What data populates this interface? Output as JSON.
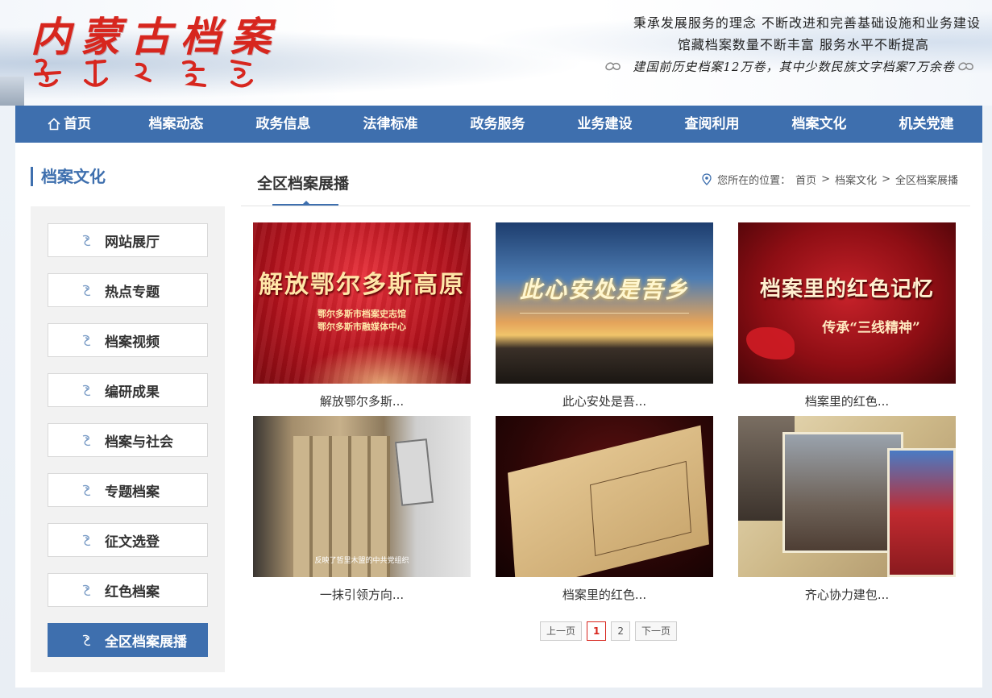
{
  "header": {
    "logo_text": "内蒙古档案",
    "slogan_line1": "秉承发展服务的理念      不断改进和完善基础设施和业务建设",
    "slogan_line2": "馆藏档案数量不断丰富      服务水平不断提高",
    "slogan_line3": "建国前历史档案12万卷，其中少数民族文字档案7万余卷"
  },
  "nav": {
    "items": [
      {
        "label": "首页",
        "icon": "home-icon"
      },
      {
        "label": "档案动态"
      },
      {
        "label": "政务信息"
      },
      {
        "label": "法律标准"
      },
      {
        "label": "政务服务"
      },
      {
        "label": "业务建设"
      },
      {
        "label": "查阅利用"
      },
      {
        "label": "档案文化"
      },
      {
        "label": "机关党建"
      }
    ]
  },
  "sidebar": {
    "title": "档案文化",
    "items": [
      {
        "label": "网站展厅"
      },
      {
        "label": "热点专题"
      },
      {
        "label": "档案视频"
      },
      {
        "label": "编研成果"
      },
      {
        "label": "档案与社会"
      },
      {
        "label": "专题档案"
      },
      {
        "label": "征文选登"
      },
      {
        "label": "红色档案"
      },
      {
        "label": "全区档案展播",
        "active": true
      }
    ]
  },
  "content": {
    "title": "全区档案展播",
    "breadcrumb": {
      "prefix": "您所在的位置：",
      "home": "首页",
      "sep": ">",
      "level1": "档案文化",
      "current": "全区档案展播"
    },
    "videos": [
      {
        "caption": "解放鄂尔多斯...",
        "thumb_title": "解放鄂尔多斯高原",
        "thumb_sub1": "鄂尔多斯市档案史志馆",
        "thumb_sub2": "鄂尔多斯市融媒体中心"
      },
      {
        "caption": "此心安处是吾...",
        "thumb_title": "此心安处是吾乡"
      },
      {
        "caption": "档案里的红色...",
        "thumb_title": "档案里的红色记忆",
        "thumb_sub1": "传承“三线精神”"
      },
      {
        "caption": "一抹引领方向...",
        "thumb_subtitle": "反映了哲里木盟的中共党组织"
      },
      {
        "caption": "档案里的红色..."
      },
      {
        "caption": "齐心协力建包..."
      }
    ]
  },
  "pager": {
    "prev": "上一页",
    "pages": [
      "1",
      "2"
    ],
    "current": "1",
    "next": "下一页"
  },
  "colors": {
    "nav_bg": "#3e6fae",
    "logo_red": "#d7261e"
  }
}
